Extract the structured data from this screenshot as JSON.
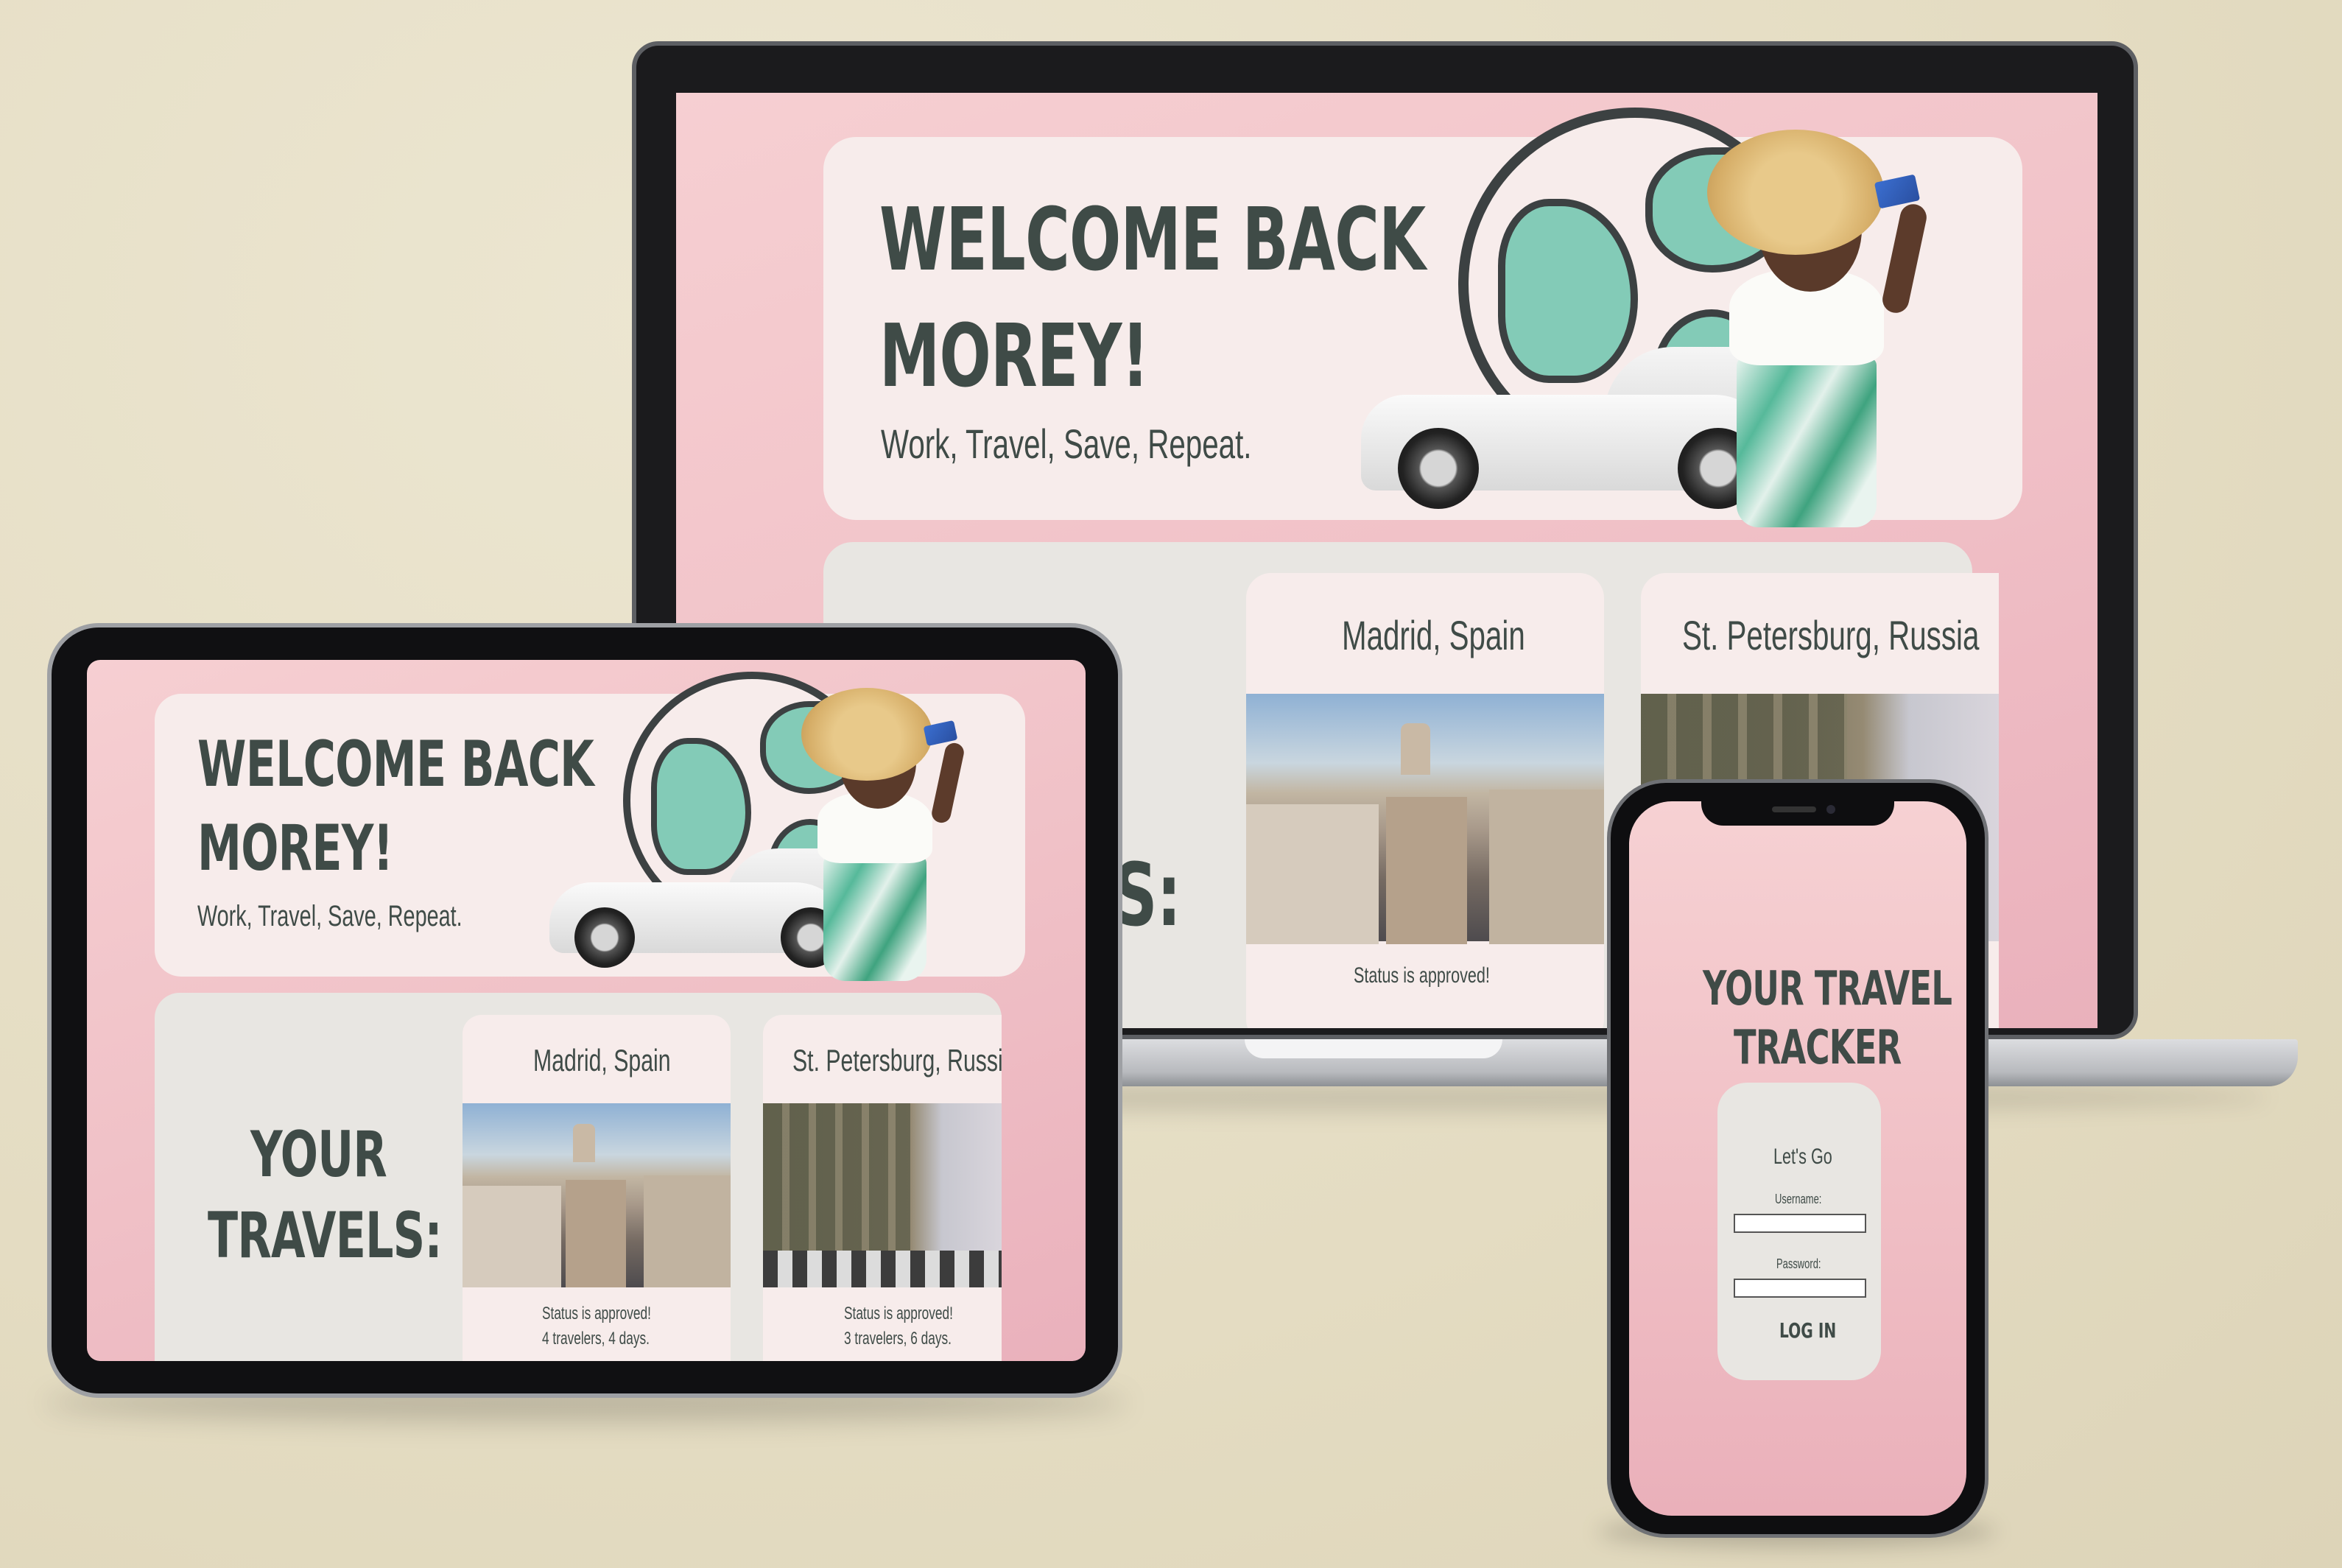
{
  "hero": {
    "welcome_line1": "WELCOME BACK",
    "welcome_line2": "MOREY!",
    "tagline": "Work, Travel, Save, Repeat."
  },
  "travels": {
    "heading_line1": "YOUR",
    "heading_line2": "TRAVELS:",
    "heading_cut": "S:",
    "cards": [
      {
        "title": "Madrid, Spain",
        "status": "Status is approved!",
        "details": "4 travelers, 4 days."
      },
      {
        "title": "St. Petersburg, Russia",
        "status": "Status is approved!",
        "details": "3 travelers, 6 days."
      }
    ]
  },
  "login": {
    "title_line1": "YOUR TRAVEL",
    "title_line2": "TRACKER",
    "subtitle": "Let's Go",
    "username_label": "Username:",
    "password_label": "Password:",
    "button_label": "LOG IN"
  }
}
